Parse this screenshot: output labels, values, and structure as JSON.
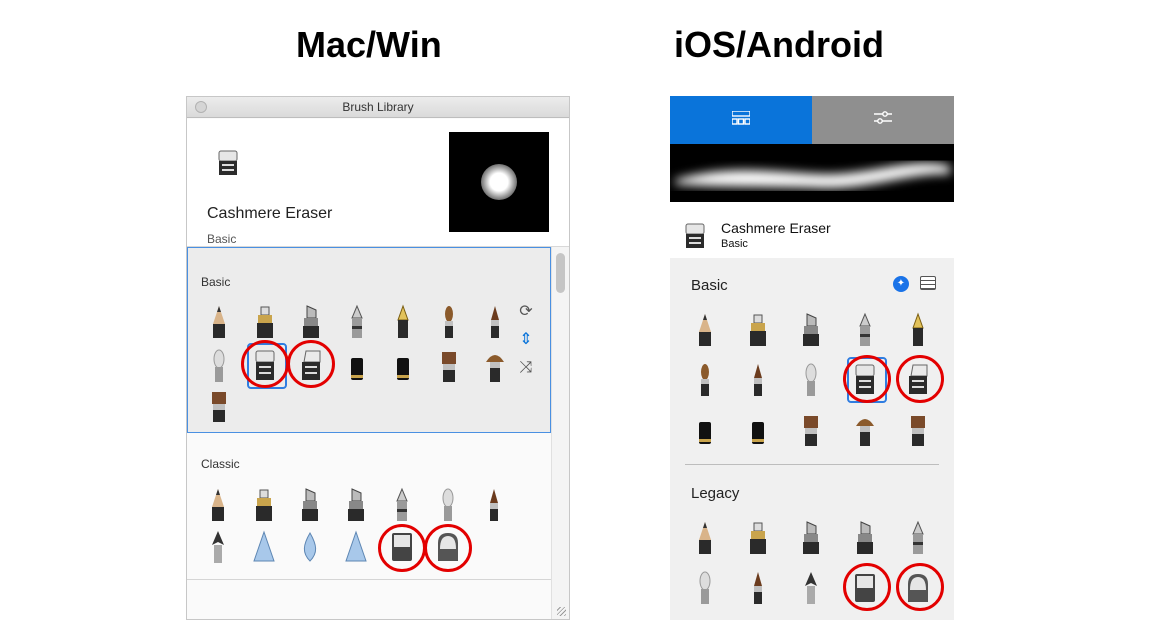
{
  "headings": {
    "mac": "Mac/Win",
    "ios": "iOS/Android"
  },
  "mac": {
    "window_title": "Brush Library",
    "brush_name": "Cashmere Eraser",
    "brush_set": "Basic",
    "sets": [
      {
        "label": "Basic"
      },
      {
        "label": "Classic"
      }
    ],
    "side_tools": [
      {
        "name": "refresh-icon",
        "glyph": "⟳"
      },
      {
        "name": "split-icon",
        "glyph": "⇕"
      },
      {
        "name": "shuffle-icon",
        "glyph": "⤨"
      }
    ]
  },
  "ios": {
    "tabs": [
      {
        "name": "brush-library-tab",
        "icon": "grid-icon"
      },
      {
        "name": "brush-properties-tab",
        "icon": "sliders-icon"
      }
    ],
    "brush_name": "Cashmere Eraser",
    "brush_set": "Basic",
    "sets": [
      {
        "label": "Basic"
      },
      {
        "label": "Legacy"
      }
    ]
  },
  "colors": {
    "accent": "#0a74da",
    "highlight_ring": "#e30000",
    "selection": "#2f7de1"
  }
}
